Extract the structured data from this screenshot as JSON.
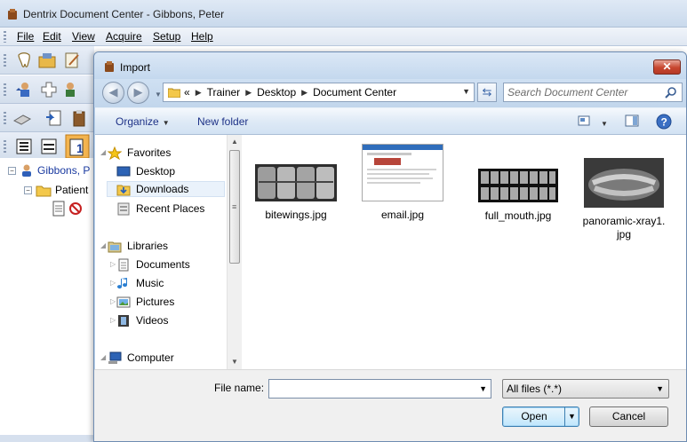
{
  "app": {
    "title": "Dentrix Document Center - Gibbons, Peter",
    "menu": [
      "File",
      "Edit",
      "View",
      "Acquire",
      "Setup",
      "Help"
    ],
    "tree": {
      "patient_label": "Gibbons, P",
      "folder_label": "Patient"
    }
  },
  "dialog": {
    "title": "Import",
    "close_glyph": "✕",
    "address": {
      "overflow": "«",
      "crumbs": [
        "Trainer",
        "Desktop",
        "Document Center"
      ]
    },
    "search_placeholder": "Search Document Center",
    "toolbar": {
      "organize": "Organize",
      "new_folder": "New folder"
    },
    "nav": {
      "favorites": "Favorites",
      "desktop": "Desktop",
      "downloads": "Downloads",
      "recent_places": "Recent Places",
      "libraries": "Libraries",
      "documents": "Documents",
      "music": "Music",
      "pictures": "Pictures",
      "videos": "Videos",
      "computer": "Computer"
    },
    "files": [
      {
        "name": "bitewings.jpg"
      },
      {
        "name": "email.jpg"
      },
      {
        "name": "full_mouth.jpg"
      },
      {
        "name": "panoramic-xray1.jpg",
        "name_line1": "panoramic-xray1.",
        "name_line2": "jpg"
      }
    ],
    "file_name_label": "File name:",
    "file_name_value": "",
    "file_type": "All files (*.*)",
    "open_label": "Open",
    "cancel_label": "Cancel"
  }
}
